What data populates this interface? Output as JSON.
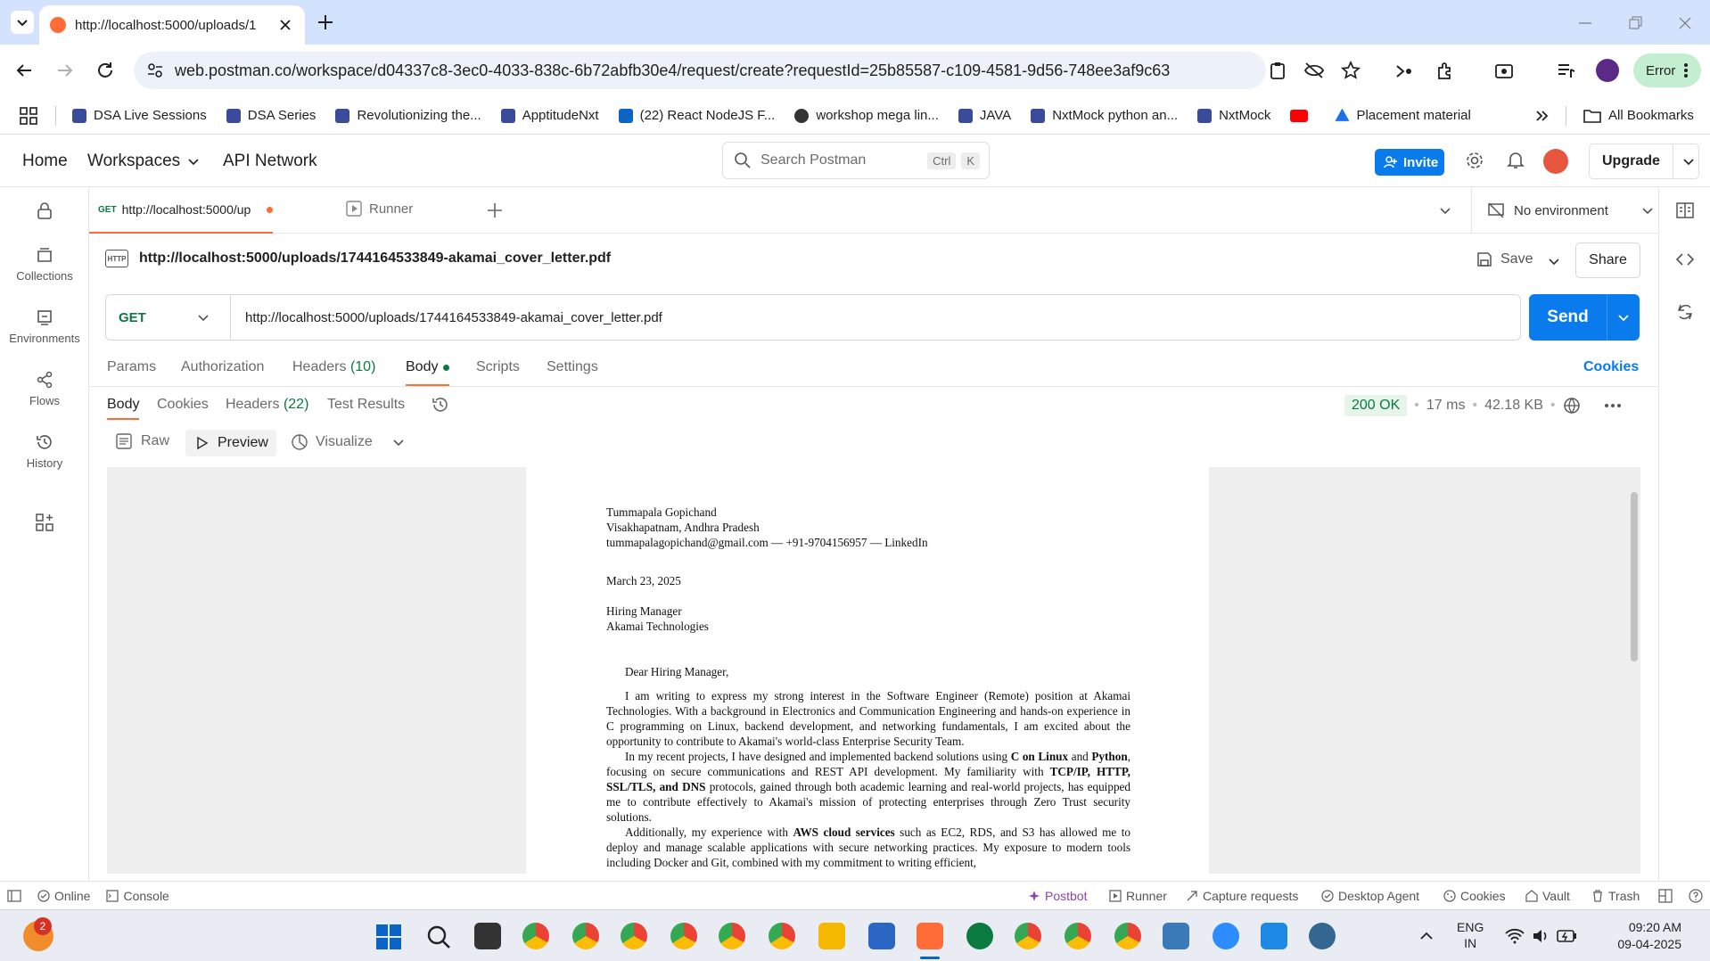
{
  "browser": {
    "tab_title": "http://localhost:5000/uploads/1",
    "url": "web.postman.co/workspace/d04337c8-3ec0-4033-838c-6b72abfb30e4/request/create?requestId=25b85587-c109-4581-9d56-748ee3af9c63",
    "profile_status": "Error",
    "bookmarks": [
      {
        "label": "DSA Live Sessions",
        "color": "#3a4b9b"
      },
      {
        "label": "DSA Series",
        "color": "#3a4b9b"
      },
      {
        "label": "Revolutionizing the...",
        "color": "#3a4b9b"
      },
      {
        "label": "ApptitudeNxt",
        "color": "#3a4b9b"
      },
      {
        "label": "(22) React NodeJS F...",
        "color": "#0a66c2"
      },
      {
        "label": "workshop mega  lin...",
        "color": "#333333"
      },
      {
        "label": "JAVA",
        "color": "#3a4b9b"
      },
      {
        "label": "NxtMock python an...",
        "color": "#3a4b9b"
      },
      {
        "label": "NxtMock",
        "color": "#3a4b9b"
      },
      {
        "label": "",
        "color": "#ff0000"
      },
      {
        "label": "Placement material",
        "color": "#1a73e8"
      }
    ],
    "all_bookmarks": "All Bookmarks"
  },
  "postman": {
    "nav": {
      "home": "Home",
      "workspaces": "Workspaces",
      "api_network": "API Network"
    },
    "search": {
      "placeholder": "Search Postman",
      "key1": "Ctrl",
      "key2": "K"
    },
    "invite": "Invite",
    "upgrade": "Upgrade",
    "sidebar": [
      "Collections",
      "Environments",
      "Flows",
      "History"
    ],
    "tabs": {
      "active_method": "GET",
      "active_label": "http://localhost:5000/up",
      "runner": "Runner"
    },
    "environment": "No environment",
    "request": {
      "title": "http://localhost:5000/uploads/1744164533849-akamai_cover_letter.pdf",
      "save": "Save",
      "share": "Share",
      "method": "GET",
      "url": "http://localhost:5000/uploads/1744164533849-akamai_cover_letter.pdf",
      "send": "Send"
    },
    "req_tabs": {
      "params": "Params",
      "authorization": "Authorization",
      "headers": "Headers",
      "headers_count": "(10)",
      "body": "Body",
      "scripts": "Scripts",
      "settings": "Settings",
      "cookies": "Cookies"
    },
    "resp_tabs": {
      "body": "Body",
      "cookies": "Cookies",
      "headers": "Headers",
      "headers_count": "(22)",
      "test_results": "Test Results"
    },
    "response": {
      "status": "200 OK",
      "time": "17 ms",
      "size": "42.18 KB"
    },
    "view_modes": {
      "raw": "Raw",
      "preview": "Preview",
      "visualize": "Visualize"
    },
    "statusbar": {
      "online": "Online",
      "console": "Console",
      "postbot": "Postbot",
      "runner": "Runner",
      "capture": "Capture requests",
      "desktop_agent": "Desktop Agent",
      "cookies": "Cookies",
      "vault": "Vault",
      "trash": "Trash"
    }
  },
  "pdf": {
    "name": "Tummapala Gopichand",
    "location": "Visakhapatnam, Andhra Pradesh",
    "contact": "tummapalagopichand@gmail.com — +91-9704156957 — LinkedIn",
    "date": "March 23, 2025",
    "recipient1": "Hiring Manager",
    "recipient2": "Akamai Technologies",
    "salutation": "Dear Hiring Manager,",
    "p1": "I am writing to express my strong interest in the Software Engineer (Remote) position at Akamai Technologies. With a background in Electronics and Communication Engineering and hands-on experience in C programming on Linux, backend development, and networking fundamentals, I am excited about the opportunity to contribute to Akamai's world-class Enterprise Security Team.",
    "p2a": "In my recent projects, I have designed and implemented backend solutions using ",
    "p2b": "C on Linux",
    "p2c": " and ",
    "p2d": "Python",
    "p2e": ", focusing on secure communications and REST API development. My familiarity with ",
    "p2f": "TCP/IP, HTTP, SSL/TLS, and DNS",
    "p2g": " protocols, gained through both academic learning and real-world projects, has equipped me to contribute effectively to Akamai's mission of protecting enterprises through Zero Trust security solutions.",
    "p3a": "Additionally, my experience with ",
    "p3b": "AWS cloud services",
    "p3c": " such as EC2, RDS, and S3 has allowed me to deploy and manage scalable applications with secure networking practices. My exposure to modern tools including Docker and Git, combined with my commitment to writing efficient,"
  },
  "taskbar": {
    "notif_count": "2",
    "lang1": "ENG",
    "lang2": "IN",
    "time": "09:20 AM",
    "date": "09-04-2025"
  }
}
